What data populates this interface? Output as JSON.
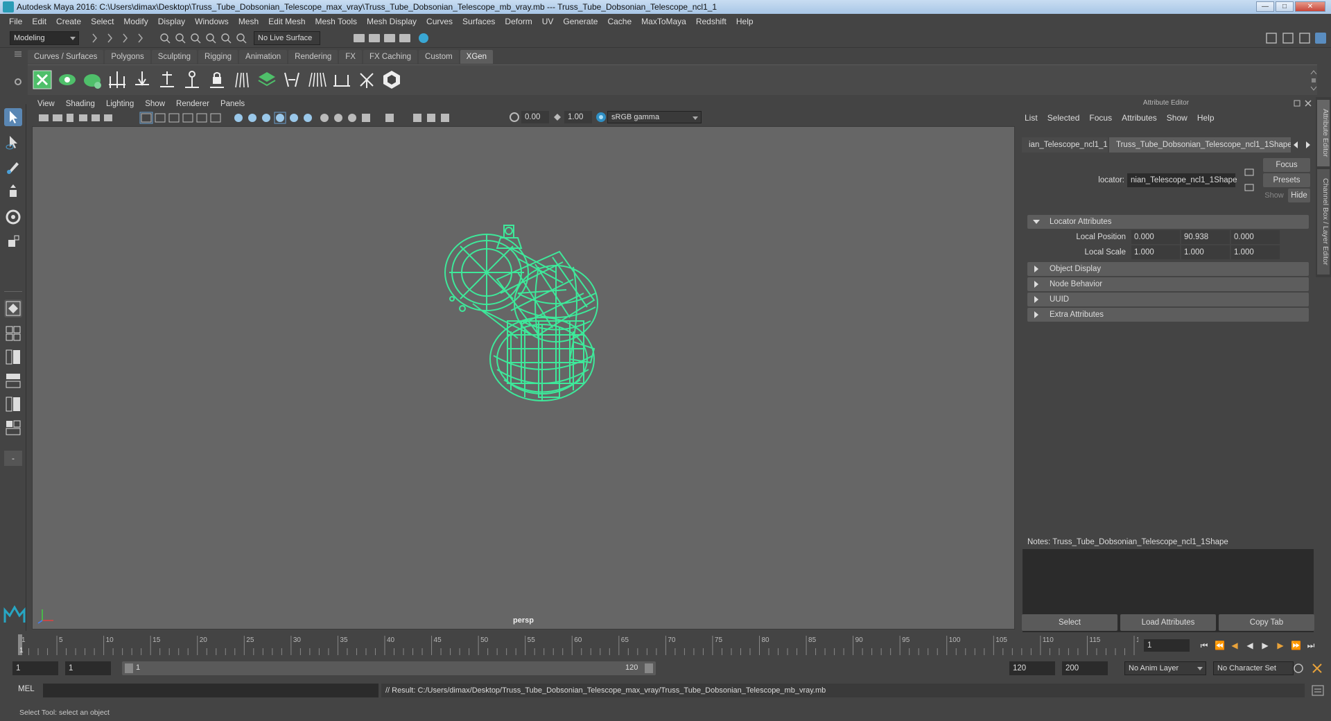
{
  "window": {
    "title": "Autodesk Maya 2016: C:\\Users\\dimax\\Desktop\\Truss_Tube_Dobsonian_Telescope_max_vray\\Truss_Tube_Dobsonian_Telescope_mb_vray.mb   ---   Truss_Tube_Dobsonian_Telescope_ncl1_1"
  },
  "menubar": [
    "File",
    "Edit",
    "Create",
    "Select",
    "Modify",
    "Display",
    "Windows",
    "Mesh",
    "Edit Mesh",
    "Mesh Tools",
    "Mesh Display",
    "Curves",
    "Surfaces",
    "Deform",
    "UV",
    "Generate",
    "Cache",
    "MaxToMaya",
    "Redshift",
    "Help"
  ],
  "statusline": {
    "mode": "Modeling",
    "live_surface": "No Live Surface"
  },
  "shelf": {
    "tabs": [
      "Curves / Surfaces",
      "Polygons",
      "Sculpting",
      "Rigging",
      "Animation",
      "Rendering",
      "FX",
      "FX Caching",
      "Custom",
      "XGen"
    ],
    "active_tab": "XGen"
  },
  "viewport": {
    "menu": [
      "View",
      "Shading",
      "Lighting",
      "Show",
      "Renderer",
      "Panels"
    ],
    "exposure": "0.00",
    "gamma": "1.00",
    "color_space": "sRGB gamma",
    "camera_label": "persp",
    "wireframe_color": "#3ee89a",
    "background_color": "#666666"
  },
  "attribute_editor": {
    "title": "Attribute Editor",
    "menu": [
      "List",
      "Selected",
      "Focus",
      "Attributes",
      "Show",
      "Help"
    ],
    "tabs": [
      "ian_Telescope_ncl1_1",
      "Truss_Tube_Dobsonian_Telescope_ncl1_1Shape"
    ],
    "node_type_label": "locator:",
    "node_name": "nian_Telescope_ncl1_1Shape",
    "buttons": {
      "focus": "Focus",
      "presets": "Presets",
      "show": "Show",
      "hide": "Hide"
    },
    "sections": [
      {
        "label": "Locator Attributes",
        "expanded": true
      },
      {
        "label": "Object Display",
        "expanded": false
      },
      {
        "label": "Node Behavior",
        "expanded": false
      },
      {
        "label": "UUID",
        "expanded": false
      },
      {
        "label": "Extra Attributes",
        "expanded": false
      }
    ],
    "local_position": {
      "label": "Local Position",
      "x": "0.000",
      "y": "90.938",
      "z": "0.000"
    },
    "local_scale": {
      "label": "Local Scale",
      "x": "1.000",
      "y": "1.000",
      "z": "1.000"
    },
    "notes_label": "Notes:  Truss_Tube_Dobsonian_Telescope_ncl1_1Shape",
    "bottom_buttons": [
      "Select",
      "Load Attributes",
      "Copy Tab"
    ]
  },
  "side_tabs": [
    "Attribute Editor",
    "Channel Box / Layer Editor"
  ],
  "timeline": {
    "ticks": [
      "1",
      "5",
      "10",
      "15",
      "20",
      "25",
      "30",
      "35",
      "40",
      "45",
      "50",
      "55",
      "60",
      "65",
      "70",
      "75",
      "80",
      "85",
      "90",
      "95",
      "100",
      "105",
      "110",
      "115",
      "120"
    ],
    "current_frame": "1"
  },
  "range": {
    "start": "1",
    "playback_start": "1",
    "slider_start": "1",
    "slider_end": "120",
    "playback_end": "120",
    "end": "200",
    "anim_layer": "No Anim Layer",
    "character_set": "No Character Set"
  },
  "command": {
    "lang": "MEL",
    "result": "// Result: C:/Users/dimax/Desktop/Truss_Tube_Dobsonian_Telescope_max_vray/Truss_Tube_Dobsonian_Telescope_mb_vray.mb"
  },
  "helpline": "Select Tool: select an object"
}
